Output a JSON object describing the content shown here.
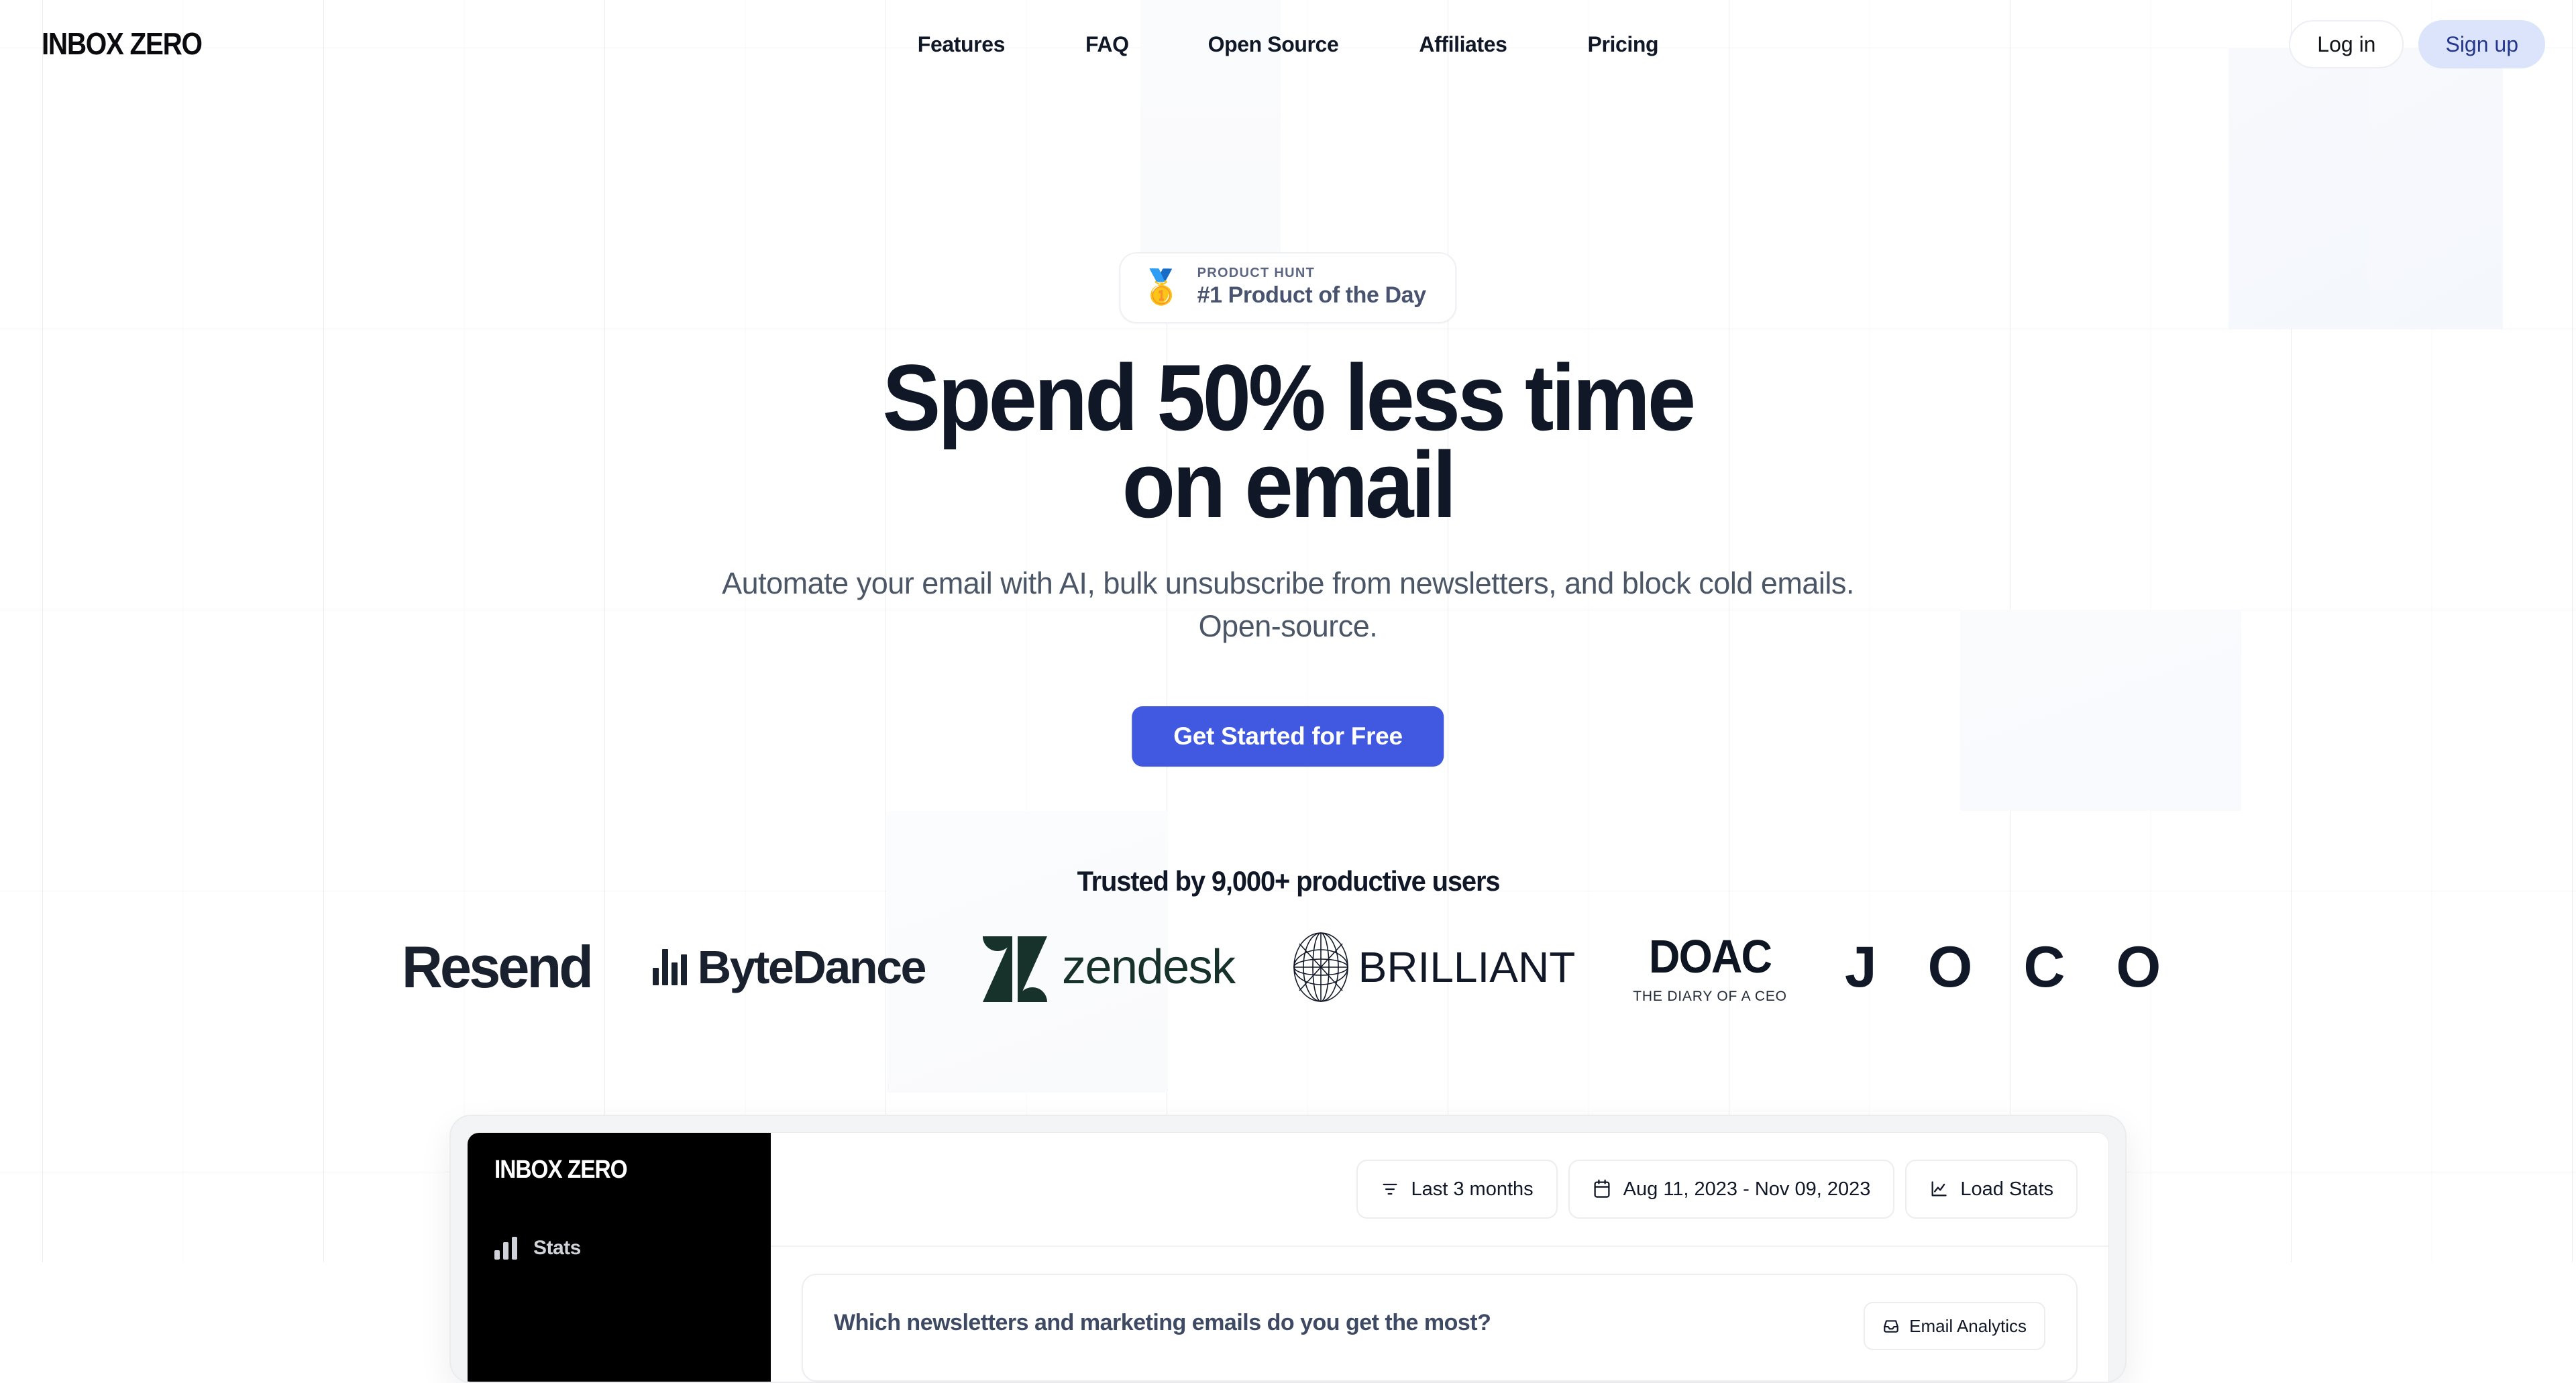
{
  "header": {
    "logo": "INBOX ZERO",
    "nav_items": [
      {
        "label": "Features"
      },
      {
        "label": "FAQ"
      },
      {
        "label": "Open Source"
      },
      {
        "label": "Affiliates"
      },
      {
        "label": "Pricing"
      }
    ],
    "login_label": "Log in",
    "signup_label": "Sign up"
  },
  "hero": {
    "badge": {
      "icon": "gold-medal-icon",
      "eyebrow": "PRODUCT HUNT",
      "title": "#1 Product of the Day"
    },
    "headline_line1": "Spend 50% less time",
    "headline_line2": "on email",
    "subheadline": "Automate your email with AI, bulk unsubscribe from newsletters, and block cold emails. Open-source.",
    "cta_label": "Get Started for Free"
  },
  "social_proof": {
    "title": "Trusted by 9,000+ productive users",
    "logos": [
      {
        "name": "Resend"
      },
      {
        "name": "ByteDance"
      },
      {
        "name": "zendesk"
      },
      {
        "name": "BRILLIANT"
      },
      {
        "name": "DOAC",
        "tagline": "THE DIARY OF A CEO"
      },
      {
        "name": "J O C O"
      }
    ]
  },
  "app_preview": {
    "sidebar": {
      "logo": "INBOX ZERO",
      "items": [
        {
          "label": "Stats",
          "icon": "bar-chart-icon"
        }
      ]
    },
    "toolbar": [
      {
        "label": "Last 3 months",
        "icon": "filter-icon"
      },
      {
        "label": "Aug 11, 2023 - Nov 09, 2023",
        "icon": "calendar-icon"
      },
      {
        "label": "Load Stats",
        "icon": "chart-icon"
      }
    ],
    "card": {
      "title": "Which newsletters and marketing emails do you get the most?",
      "action_label": "Email Analytics",
      "action_icon": "inbox-icon"
    }
  },
  "colors": {
    "accent_blue": "#4059e0",
    "signup_bg": "#dbe4fb",
    "signup_text": "#24368c",
    "heading": "#101828",
    "body_text": "#4b5666",
    "badge_text": "#47536f",
    "sidebar_bg": "#000000",
    "zendesk_green": "#17312b"
  }
}
